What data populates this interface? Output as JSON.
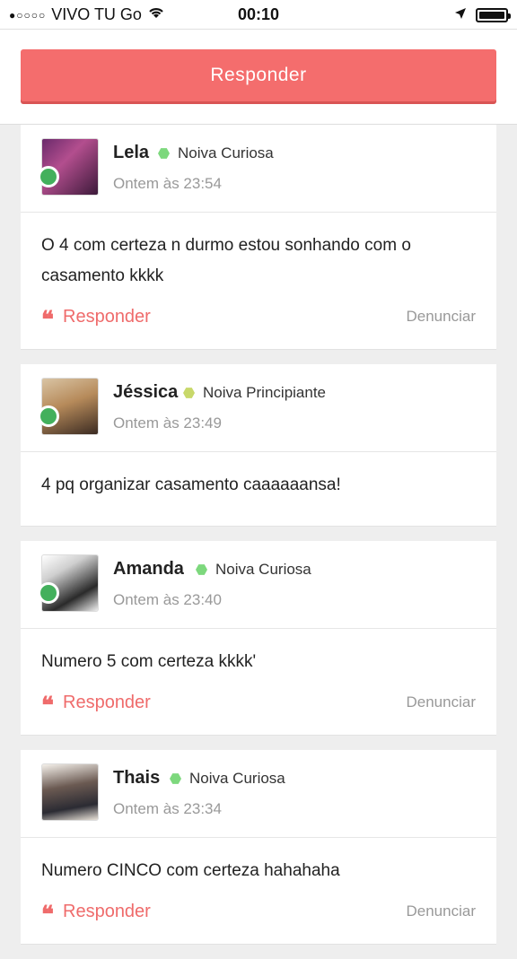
{
  "status_bar": {
    "carrier": "VIVO TU Go",
    "time": "00:10"
  },
  "top_panel": {
    "reply_button": "Responder"
  },
  "comments": [
    {
      "name": "Lela",
      "rank": "Noiva Curiosa",
      "time": "Ontem às 23:54",
      "text": "O 4 com certeza n durmo estou sonhando com o casamento kkkk",
      "reply": "Responder",
      "report": "Denunciar"
    },
    {
      "name": "Jéssica",
      "rank": "Noiva Principiante",
      "time": "Ontem às 23:49",
      "text": "4 pq organizar casamento caaaaaansa!"
    },
    {
      "name": "Amanda",
      "rank": "Noiva Curiosa",
      "time": "Ontem às 23:40",
      "text": "Numero 5 com certeza kkkk'",
      "reply": "Responder",
      "report": "Denunciar"
    },
    {
      "name": "Thais",
      "rank": "Noiva Curiosa",
      "time": "Ontem às 23:34",
      "text": "Numero CINCO com certeza hahahaha",
      "reply": "Responder",
      "report": "Denunciar"
    }
  ],
  "colors": {
    "accent": "#f46d6d",
    "online": "#43b05c",
    "rank_curiosa": "#7dd87d",
    "rank_principiante": "#c8d86a"
  }
}
